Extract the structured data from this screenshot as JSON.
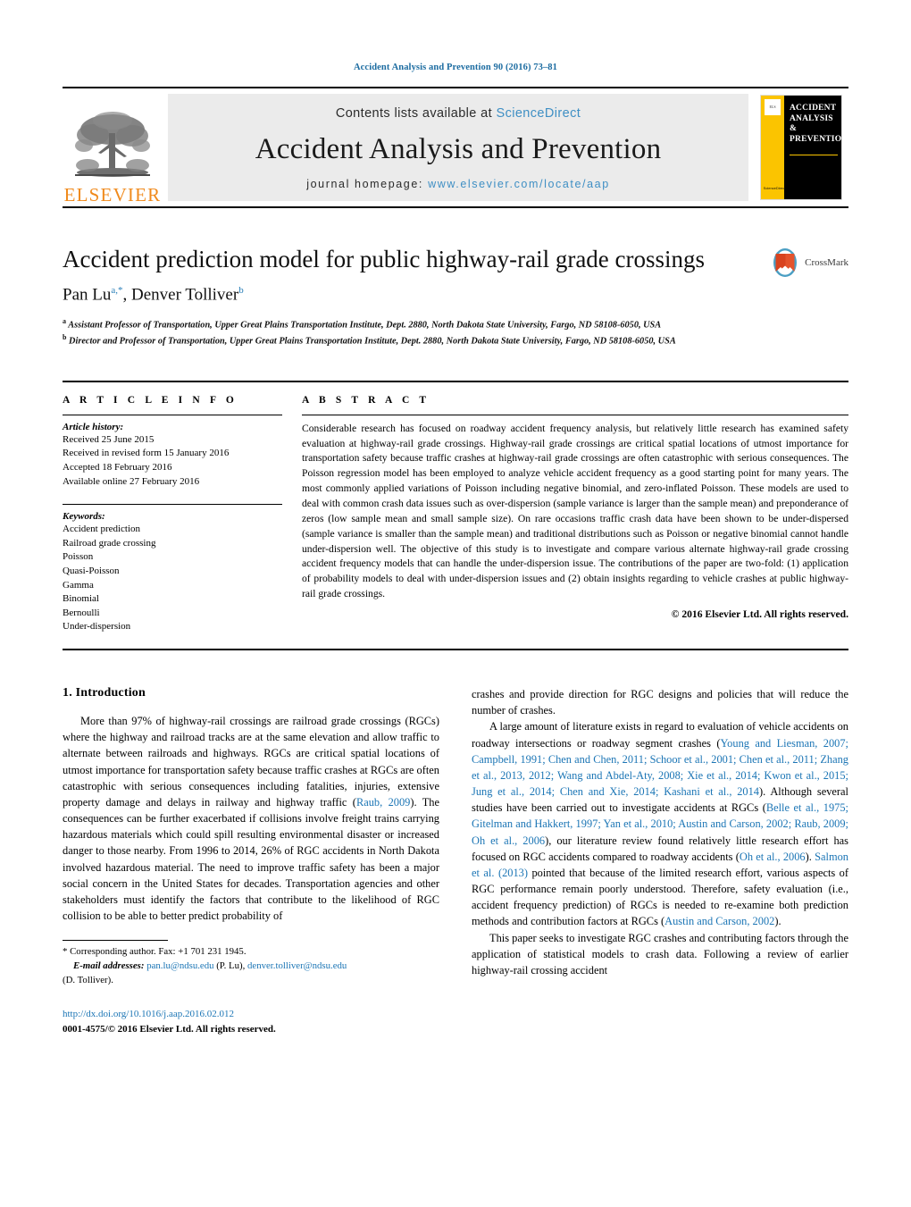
{
  "running_head": "Accident Analysis and Prevention 90 (2016) 73–81",
  "masthead": {
    "contents_prefix": "Contents lists available at ",
    "sciencedirect": "ScienceDirect",
    "journal_title": "Accident Analysis and Prevention",
    "homepage_prefix": "journal homepage: ",
    "homepage_url": "www.elsevier.com/locate/aap",
    "publisher": "ELSEVIER",
    "cover_title": "ACCIDENT ANALYSIS & PREVENTION",
    "cover_sciencedirect": "ScienceDirect"
  },
  "article": {
    "title": "Accident prediction model for public highway-rail grade crossings",
    "authors_html": "Pan Lu",
    "author1": "Pan Lu",
    "author1_sup": "a,*",
    "author2": "Denver Tolliver",
    "author2_sup": "b",
    "affiliation_a_sup": "a",
    "affiliation_a": "Assistant Professor of Transportation, Upper Great Plains Transportation Institute, Dept. 2880, North Dakota State University, Fargo, ND 58108-6050, USA",
    "affiliation_b_sup": "b",
    "affiliation_b": "Director and Professor of Transportation, Upper Great Plains Transportation Institute, Dept. 2880, North Dakota State University, Fargo, ND 58108-6050, USA",
    "crossmark_label": "CrossMark"
  },
  "info": {
    "heading": "A R T I C L E   I N F O",
    "history_label": "Article history:",
    "history": [
      "Received 25 June 2015",
      "Received in revised form 15 January 2016",
      "Accepted 18 February 2016",
      "Available online 27 February 2016"
    ],
    "keywords_label": "Keywords:",
    "keywords": [
      "Accident prediction",
      "Railroad grade crossing",
      "Poisson",
      "Quasi-Poisson",
      "Gamma",
      "Binomial",
      "Bernoulli",
      "Under-dispersion"
    ]
  },
  "abstract": {
    "heading": "A B S T R A C T",
    "text": "Considerable research has focused on roadway accident frequency analysis, but relatively little research has examined safety evaluation at highway-rail grade crossings. Highway-rail grade crossings are critical spatial locations of utmost importance for transportation safety because traffic crashes at highway-rail grade crossings are often catastrophic with serious consequences. The Poisson regression model has been employed to analyze vehicle accident frequency as a good starting point for many years. The most commonly applied variations of Poisson including negative binomial, and zero-inflated Poisson. These models are used to deal with common crash data issues such as over-dispersion (sample variance is larger than the sample mean) and preponderance of zeros (low sample mean and small sample size). On rare occasions traffic crash data have been shown to be under-dispersed (sample variance is smaller than the sample mean) and traditional distributions such as Poisson or negative binomial cannot handle under-dispersion well. The objective of this study is to investigate and compare various alternate highway-rail grade crossing accident frequency models that can handle the under-dispersion issue. The contributions of the paper are two-fold: (1) application of probability models to deal with under-dispersion issues and (2) obtain insights regarding to vehicle crashes at public highway-rail grade crossings.",
    "copyright": "© 2016 Elsevier Ltd. All rights reserved."
  },
  "introduction": {
    "section_title": "1.  Introduction",
    "para1_part1": "More than 97% of highway-rail crossings are railroad grade crossings (RGCs) where the highway and railroad tracks are at the same elevation and allow traffic to alternate between railroads and highways. RGCs are critical spatial locations of utmost importance for transportation safety because traffic crashes at RGCs are often catastrophic with serious consequences including fatalities, injuries, extensive property damage and delays in railway and highway traffic (",
    "para1_ref1": "Raub, 2009",
    "para1_part2": "). The consequences can be further exacerbated if collisions involve freight trains carrying hazardous materials which could spill resulting environmental disaster or increased danger to those nearby. From 1996 to 2014, 26% of RGC accidents in North Dakota involved hazardous material. The need to improve traffic safety has been a major social concern in the United States for decades. Transportation agencies and other stakeholders must identify the factors that contribute to the likelihood of RGC collision to be able to better predict probability of crashes and provide direction for RGC designs and policies that will reduce the number of crashes.",
    "para2_part1": "A large amount of literature exists in regard to evaluation of vehicle accidents on roadway intersections or roadway segment crashes (",
    "para2_ref1": "Young and Liesman, 2007; Campbell, 1991; Chen and Chen, 2011; Schoor et al., 2001; Chen et al., 2011; Zhang et al., 2013, 2012; Wang and Abdel-Aty, 2008; Xie et al., 2014; Kwon et al., 2015; Jung et al., 2014; Chen and Xie, 2014; Kashani et al., 2014",
    "para2_part2": "). Although several studies have been carried out to investigate accidents at RGCs (",
    "para2_ref2": "Belle et al., 1975; Gitelman and Hakkert, 1997; Yan et al., 2010; Austin and Carson, 2002; Raub, 2009; Oh et al., 2006",
    "para2_part3": "), our literature review found relatively little research effort has focused on RGC accidents compared to roadway accidents (",
    "para2_ref3": "Oh et al., 2006",
    "para2_part4": "). ",
    "para2_ref4": "Salmon et al. (2013)",
    "para2_part5": " pointed that because of the limited research effort, various aspects of RGC performance remain poorly understood. Therefore, safety evaluation (i.e., accident frequency prediction) of RGCs is needed to re-examine both prediction methods and contribution factors at RGCs (",
    "para2_ref5": "Austin and Carson, 2002",
    "para2_part6": ").",
    "para3": "This paper seeks to investigate RGC crashes and contributing factors through the application of statistical models to crash data. Following a review of earlier highway-rail crossing accident"
  },
  "footnote": {
    "star": "*",
    "corresponding": " Corresponding author. Fax: +1 701 231 1945.",
    "email_label": "E-mail addresses:",
    "email1": "pan.lu@ndsu.edu",
    "email1_name": " (P. Lu), ",
    "email2": "denver.tolliver@ndsu.edu",
    "email2_name": "(D. Tolliver)."
  },
  "footer": {
    "doi": "http://dx.doi.org/10.1016/j.aap.2016.02.012",
    "issn": "0001-4575/© 2016 Elsevier Ltd. All rights reserved."
  },
  "colors": {
    "link": "#1b75b5",
    "running_head": "#1c6ca1",
    "elsevier_orange": "#f08a1c",
    "cover_yellow": "#fbc400",
    "masthead_bg": "#ebebeb"
  }
}
